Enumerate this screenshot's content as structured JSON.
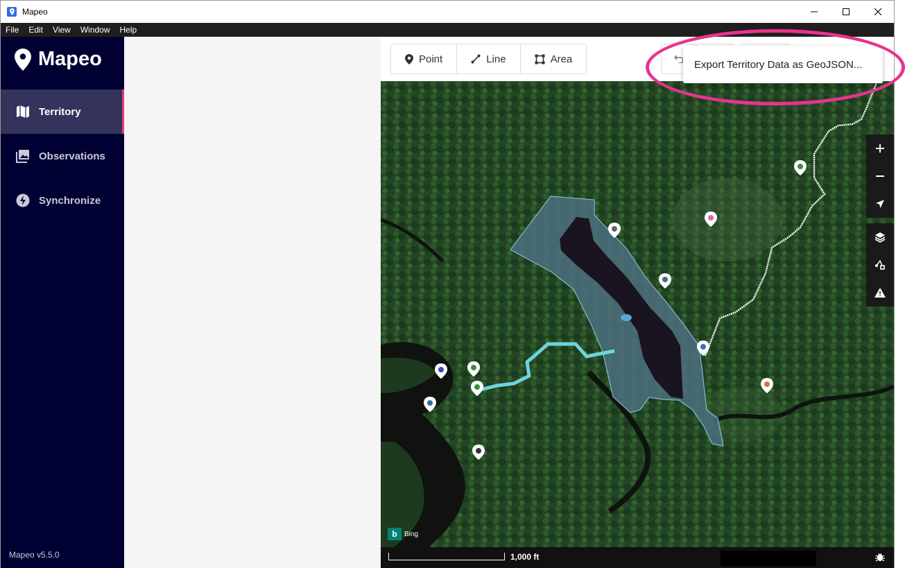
{
  "window": {
    "title": "Mapeo"
  },
  "menu": [
    "File",
    "Edit",
    "View",
    "Window",
    "Help"
  ],
  "sidebar": {
    "logo": "Mapeo",
    "items": [
      {
        "label": "Territory",
        "icon": "map-icon",
        "active": true
      },
      {
        "label": "Observations",
        "icon": "photos-icon",
        "active": false
      },
      {
        "label": "Synchronize",
        "icon": "bolt-icon",
        "active": false
      }
    ],
    "version": "Mapeo v5.5.0"
  },
  "toolbar": {
    "point_label": "Point",
    "line_label": "Line",
    "area_label": "Area"
  },
  "dropdown": {
    "export_label": "Export Territory Data as GeoJSON..."
  },
  "map": {
    "attribution": "Bing",
    "scale_label": "1,000 ft"
  },
  "colors": {
    "sidebar_bg": "#000033",
    "accent": "#e33b6b",
    "highlight": "#e8338f"
  }
}
